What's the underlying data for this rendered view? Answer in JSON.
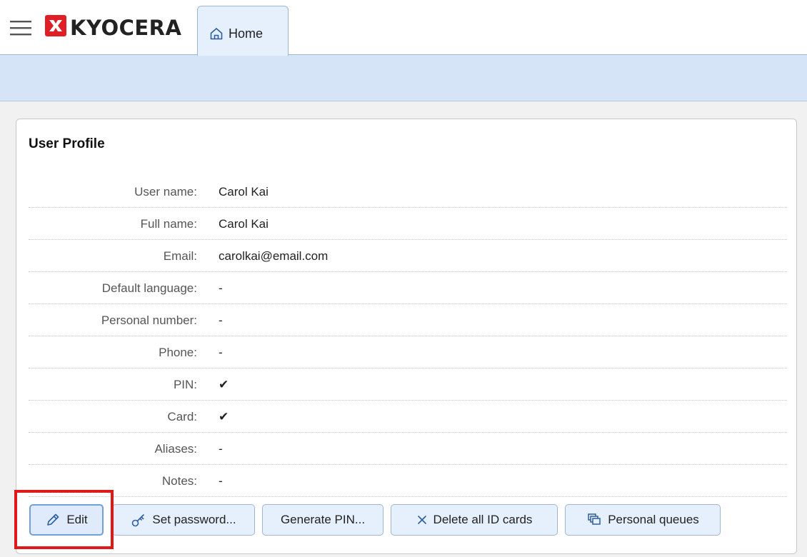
{
  "header": {
    "brand": "KYOCERA",
    "tabs": [
      {
        "label": "Home",
        "icon": "home-icon"
      }
    ]
  },
  "profile": {
    "title": "User Profile",
    "fields": [
      {
        "label": "User name:",
        "value": "Carol Kai"
      },
      {
        "label": "Full name:",
        "value": "Carol Kai"
      },
      {
        "label": "Email:",
        "value": "carolkai@email.com"
      },
      {
        "label": "Default language:",
        "value": "-"
      },
      {
        "label": "Personal number:",
        "value": "-"
      },
      {
        "label": "Phone:",
        "value": "-"
      },
      {
        "label": "PIN:",
        "value": "✔"
      },
      {
        "label": "Card:",
        "value": "✔"
      },
      {
        "label": "Aliases:",
        "value": "-"
      },
      {
        "label": "Notes:",
        "value": "-"
      }
    ]
  },
  "actions": {
    "edit": "Edit",
    "set_password": "Set password...",
    "generate_pin": "Generate PIN...",
    "delete_cards": "Delete all ID cards",
    "personal_queues": "Personal queues"
  },
  "colors": {
    "brand_red": "#e01e26",
    "tab_bg": "#e6effc",
    "band_bg": "#d6e4f7",
    "highlight": "#e01818"
  }
}
